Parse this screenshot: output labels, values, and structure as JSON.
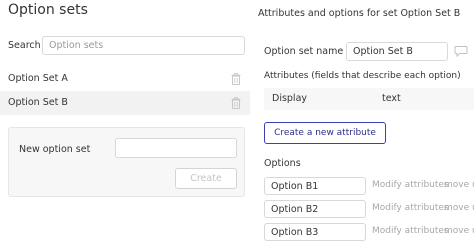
{
  "left_panel": {
    "title": "Option sets",
    "search_label": "Search",
    "search_placeholder": "Option sets",
    "items": [
      {
        "label": "Option Set A",
        "icon": "trash-icon"
      },
      {
        "label": "Option Set B",
        "icon": "trash-icon",
        "selected": true
      }
    ],
    "new_option_set": {
      "label": "New option set",
      "value": "",
      "create_label": "Create"
    }
  },
  "right_panel": {
    "title": "Attributes and options for set Option Set B",
    "name_label": "Option set name",
    "name_value": "Option Set B",
    "comment_icon": "comment-icon",
    "attributes_title": "Attributes (fields that describe each option)",
    "attributes": [
      {
        "name": "Display",
        "type": "text"
      }
    ],
    "create_attribute_label": "Create a new attribute",
    "options_title": "Options",
    "options": [
      {
        "value": "Option B1",
        "modify_label": "Modify attributes",
        "move_label": "move u"
      },
      {
        "value": "Option B2",
        "modify_label": "Modify attributes",
        "move_label": "move u"
      },
      {
        "value": "Option B3",
        "modify_label": "Modify attributes",
        "move_label": "move u"
      }
    ]
  },
  "colors": {
    "accent": "#3b3fb6",
    "muted_text": "#a8a8a8",
    "selected_bg": "#f2f2f2"
  }
}
